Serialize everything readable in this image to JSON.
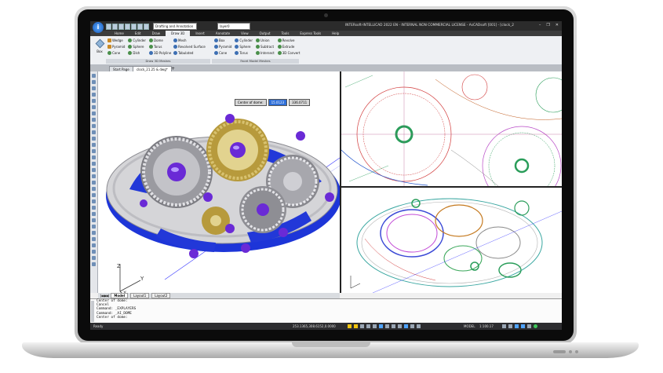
{
  "app": {
    "window_title": "INTERsoft-INTELLICAD 2022 EN - INTERNAL NON COMMERCIAL LICENSE - AsCADsoft [001] - [clock_2",
    "app_button_glyph": "i",
    "workspace": "Drafting and Annotation",
    "layer": "layer0",
    "window_controls": [
      "–",
      "❐",
      "✕"
    ]
  },
  "ribbon": {
    "tabs": [
      {
        "label": "Home",
        "active": false
      },
      {
        "label": "Edit",
        "active": false
      },
      {
        "label": "Draw",
        "active": false
      },
      {
        "label": "Draw 3D",
        "active": true
      },
      {
        "label": "Insert",
        "active": false
      },
      {
        "label": "Annotate",
        "active": false
      },
      {
        "label": "View",
        "active": false
      },
      {
        "label": "Output",
        "active": false
      },
      {
        "label": "Tools",
        "active": false
      },
      {
        "label": "Express Tools",
        "active": false
      },
      {
        "label": "Help",
        "active": false
      }
    ],
    "box_label": "Box",
    "group1_items": [
      "Wedge",
      "Cylinder",
      "Dome",
      "Pyramid",
      "Sphere",
      "Torus",
      "Cone",
      "Dish",
      "3D Polyline"
    ],
    "mesh_items": [
      "Mesh",
      "Revolved Surface",
      "Tabulated"
    ],
    "group1_label": "Draw 3D Meshes",
    "group2_items": [
      "Box",
      "Cylinder",
      "Union",
      "Revolve",
      "Pyramid",
      "Sphere",
      "Subtract",
      "Extrude",
      "Cone",
      "Torus",
      "Intersect",
      "3D Convert"
    ],
    "group2_label": "Facet Model Meshes"
  },
  "documents": {
    "tabs": [
      {
        "label": "Start Page",
        "active": false
      },
      {
        "label": "clock_21.25 & dwg*",
        "active": true
      }
    ],
    "add_symbol": "+"
  },
  "viewport_main": {
    "prompt_label": "Center of dome:",
    "prompt_x": "15.0123",
    "prompt_y": "336.0711",
    "ucs_labels": {
      "z": "Z",
      "y": "Y",
      "x": "X"
    }
  },
  "layout_tabs": {
    "nav": "|◀ ◀ ▶ ▶|",
    "tabs": [
      {
        "label": "Model",
        "active": true
      },
      {
        "label": "Layout1",
        "active": false
      },
      {
        "label": "Layout2",
        "active": false
      }
    ]
  },
  "command_line": {
    "lines": [
      "Center of dome:",
      "Cancel",
      "Command: _EXPLAYERS",
      "Command: _AI_DOME",
      "Center of dome:"
    ]
  },
  "status_bar": {
    "ready": "Ready",
    "coords": "253.1365,308.6152,0.0000",
    "model": "MODEL",
    "scale": "1:100.17"
  },
  "colors": {
    "accent_blue": "#2f6fd8",
    "dome_purple": "#6a2ad6",
    "clock_gold": "#b79a3c"
  }
}
